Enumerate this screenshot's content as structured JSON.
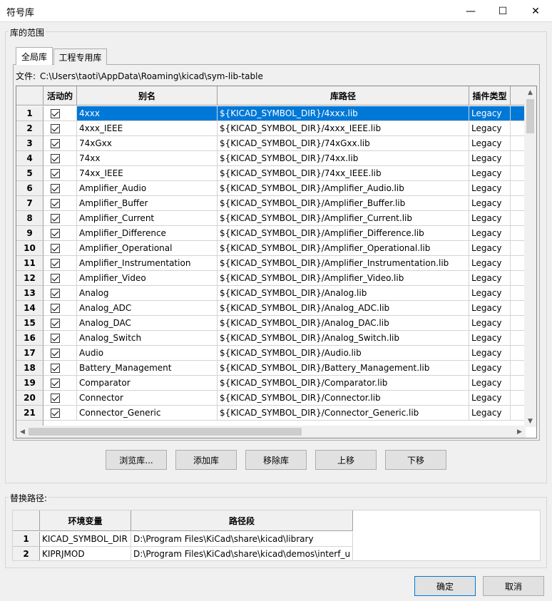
{
  "window": {
    "title": "符号库",
    "min": "—",
    "max": "☐",
    "close": "✕"
  },
  "library_scope": {
    "label": "库的范围",
    "tabs": [
      {
        "label": "全局库"
      },
      {
        "label": "工程专用库"
      }
    ],
    "file_label": "文件:",
    "file_path": "C:\\Users\\taoti\\AppData\\Roaming\\kicad\\sym-lib-table",
    "table": {
      "columns": [
        "活动的",
        "别名",
        "库路径",
        "插件类型"
      ],
      "rows": [
        {
          "n": "1",
          "alias": "4xxx",
          "path": "${KICAD_SYMBOL_DIR}/4xxx.lib",
          "type": "Legacy"
        },
        {
          "n": "2",
          "alias": "4xxx_IEEE",
          "path": "${KICAD_SYMBOL_DIR}/4xxx_IEEE.lib",
          "type": "Legacy"
        },
        {
          "n": "3",
          "alias": "74xGxx",
          "path": "${KICAD_SYMBOL_DIR}/74xGxx.lib",
          "type": "Legacy"
        },
        {
          "n": "4",
          "alias": "74xx",
          "path": "${KICAD_SYMBOL_DIR}/74xx.lib",
          "type": "Legacy"
        },
        {
          "n": "5",
          "alias": "74xx_IEEE",
          "path": "${KICAD_SYMBOL_DIR}/74xx_IEEE.lib",
          "type": "Legacy"
        },
        {
          "n": "6",
          "alias": "Amplifier_Audio",
          "path": "${KICAD_SYMBOL_DIR}/Amplifier_Audio.lib",
          "type": "Legacy"
        },
        {
          "n": "7",
          "alias": "Amplifier_Buffer",
          "path": "${KICAD_SYMBOL_DIR}/Amplifier_Buffer.lib",
          "type": "Legacy"
        },
        {
          "n": "8",
          "alias": "Amplifier_Current",
          "path": "${KICAD_SYMBOL_DIR}/Amplifier_Current.lib",
          "type": "Legacy"
        },
        {
          "n": "9",
          "alias": "Amplifier_Difference",
          "path": "${KICAD_SYMBOL_DIR}/Amplifier_Difference.lib",
          "type": "Legacy"
        },
        {
          "n": "10",
          "alias": "Amplifier_Operational",
          "path": "${KICAD_SYMBOL_DIR}/Amplifier_Operational.lib",
          "type": "Legacy"
        },
        {
          "n": "11",
          "alias": "Amplifier_Instrumentation",
          "path": "${KICAD_SYMBOL_DIR}/Amplifier_Instrumentation.lib",
          "type": "Legacy"
        },
        {
          "n": "12",
          "alias": "Amplifier_Video",
          "path": "${KICAD_SYMBOL_DIR}/Amplifier_Video.lib",
          "type": "Legacy"
        },
        {
          "n": "13",
          "alias": "Analog",
          "path": "${KICAD_SYMBOL_DIR}/Analog.lib",
          "type": "Legacy"
        },
        {
          "n": "14",
          "alias": "Analog_ADC",
          "path": "${KICAD_SYMBOL_DIR}/Analog_ADC.lib",
          "type": "Legacy"
        },
        {
          "n": "15",
          "alias": "Analog_DAC",
          "path": "${KICAD_SYMBOL_DIR}/Analog_DAC.lib",
          "type": "Legacy"
        },
        {
          "n": "16",
          "alias": "Analog_Switch",
          "path": "${KICAD_SYMBOL_DIR}/Analog_Switch.lib",
          "type": "Legacy"
        },
        {
          "n": "17",
          "alias": "Audio",
          "path": "${KICAD_SYMBOL_DIR}/Audio.lib",
          "type": "Legacy"
        },
        {
          "n": "18",
          "alias": "Battery_Management",
          "path": "${KICAD_SYMBOL_DIR}/Battery_Management.lib",
          "type": "Legacy"
        },
        {
          "n": "19",
          "alias": "Comparator",
          "path": "${KICAD_SYMBOL_DIR}/Comparator.lib",
          "type": "Legacy"
        },
        {
          "n": "20",
          "alias": "Connector",
          "path": "${KICAD_SYMBOL_DIR}/Connector.lib",
          "type": "Legacy"
        },
        {
          "n": "21",
          "alias": "Connector_Generic",
          "path": "${KICAD_SYMBOL_DIR}/Connector_Generic.lib",
          "type": "Legacy"
        }
      ]
    },
    "buttons": {
      "browse": "浏览库...",
      "add": "添加库",
      "remove": "移除库",
      "up": "上移",
      "down": "下移"
    }
  },
  "path_substitutions": {
    "label": "替换路径:",
    "columns": [
      "环境变量",
      "路径段"
    ],
    "rows": [
      {
        "n": "1",
        "var": "KICAD_SYMBOL_DIR",
        "path": "D:\\Program Files\\KiCad\\share\\kicad\\library"
      },
      {
        "n": "2",
        "var": "KIPRJMOD",
        "path": "D:\\Program Files\\KiCad\\share\\kicad\\demos\\interf_u"
      }
    ]
  },
  "dialog_buttons": {
    "ok": "确定",
    "cancel": "取消"
  },
  "colors": {
    "selection": "#0078d7",
    "window_bg": "#f0f0f0"
  }
}
